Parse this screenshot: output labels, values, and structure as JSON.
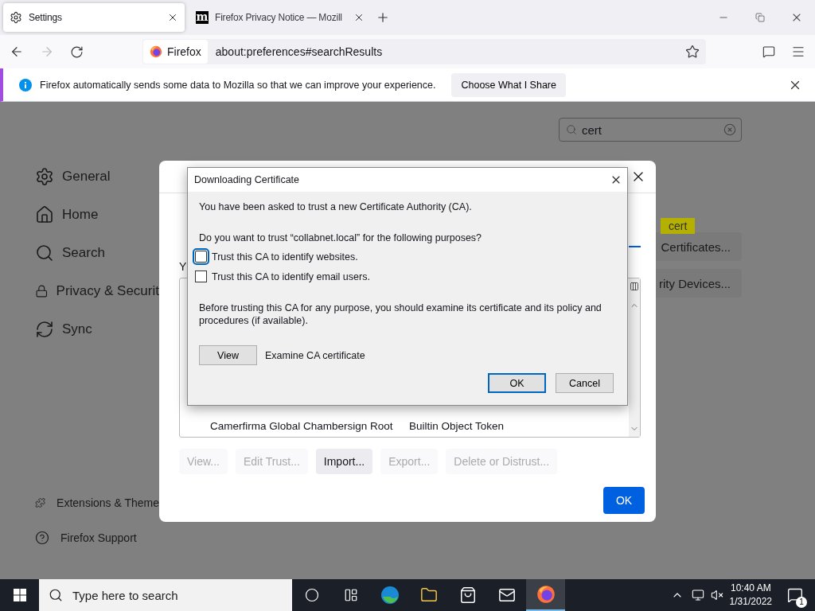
{
  "browser_tabs": [
    {
      "title": "Settings",
      "selected": true
    },
    {
      "title": "Firefox Privacy Notice — Mozill",
      "favicon": "m",
      "selected": false
    }
  ],
  "address_bar": {
    "identity": "Firefox",
    "url": "about:preferences#searchResults"
  },
  "notification": {
    "message": "Firefox automatically sends some data to Mozilla so that we can improve your experience.",
    "button": "Choose What I Share"
  },
  "settings_search": {
    "value": "cert"
  },
  "sidebar": {
    "items": [
      {
        "label": "General",
        "kind": "gear"
      },
      {
        "label": "Home",
        "kind": "home"
      },
      {
        "label": "Search",
        "kind": "search"
      },
      {
        "label": "Privacy & Securit",
        "kind": "lock"
      },
      {
        "label": "Sync",
        "kind": "sync"
      }
    ],
    "footer_items": [
      {
        "label": "Extensions & Theme",
        "kind": "puzzle"
      },
      {
        "label": "Firefox Support",
        "kind": "help"
      }
    ]
  },
  "search_highlight": "cert",
  "background_buttons": [
    "Certificates...",
    "rity Devices..."
  ],
  "certificate_manager": {
    "partial_text": "Y",
    "rows": [
      {
        "column_1": "Camerfirma Global Chambersign Root",
        "column_2": "Builtin Object Token"
      }
    ],
    "buttons": [
      {
        "label": "View...",
        "disabled": true
      },
      {
        "label": "Edit Trust...",
        "disabled": true
      },
      {
        "label": "Import...",
        "disabled": false
      },
      {
        "label": "Export...",
        "disabled": true
      },
      {
        "label": "Delete or Distrust...",
        "disabled": true
      }
    ],
    "ok": "OK"
  },
  "dialog": {
    "title": "Downloading Certificate",
    "intro": "You have been asked to trust a new Certificate Authority (CA).",
    "question": "Do you want to trust “collabnet.local” for the following purposes?",
    "options": [
      {
        "label": "Trust this CA to identify websites.",
        "checked": false,
        "focused": true
      },
      {
        "label": "Trust this CA to identify email users.",
        "checked": false,
        "focused": false
      }
    ],
    "note": "Before trusting this CA for any purpose, you should examine its certificate and its policy and procedures (if available).",
    "view_button": "View",
    "view_caption": "Examine CA certificate",
    "buttons": [
      {
        "label": "OK",
        "default": true
      },
      {
        "label": "Cancel",
        "default": false
      }
    ]
  },
  "taskbar": {
    "search_placeholder": "Type here to search",
    "time": "10:40 AM",
    "date": "1/31/2022",
    "notification_count": "1"
  }
}
